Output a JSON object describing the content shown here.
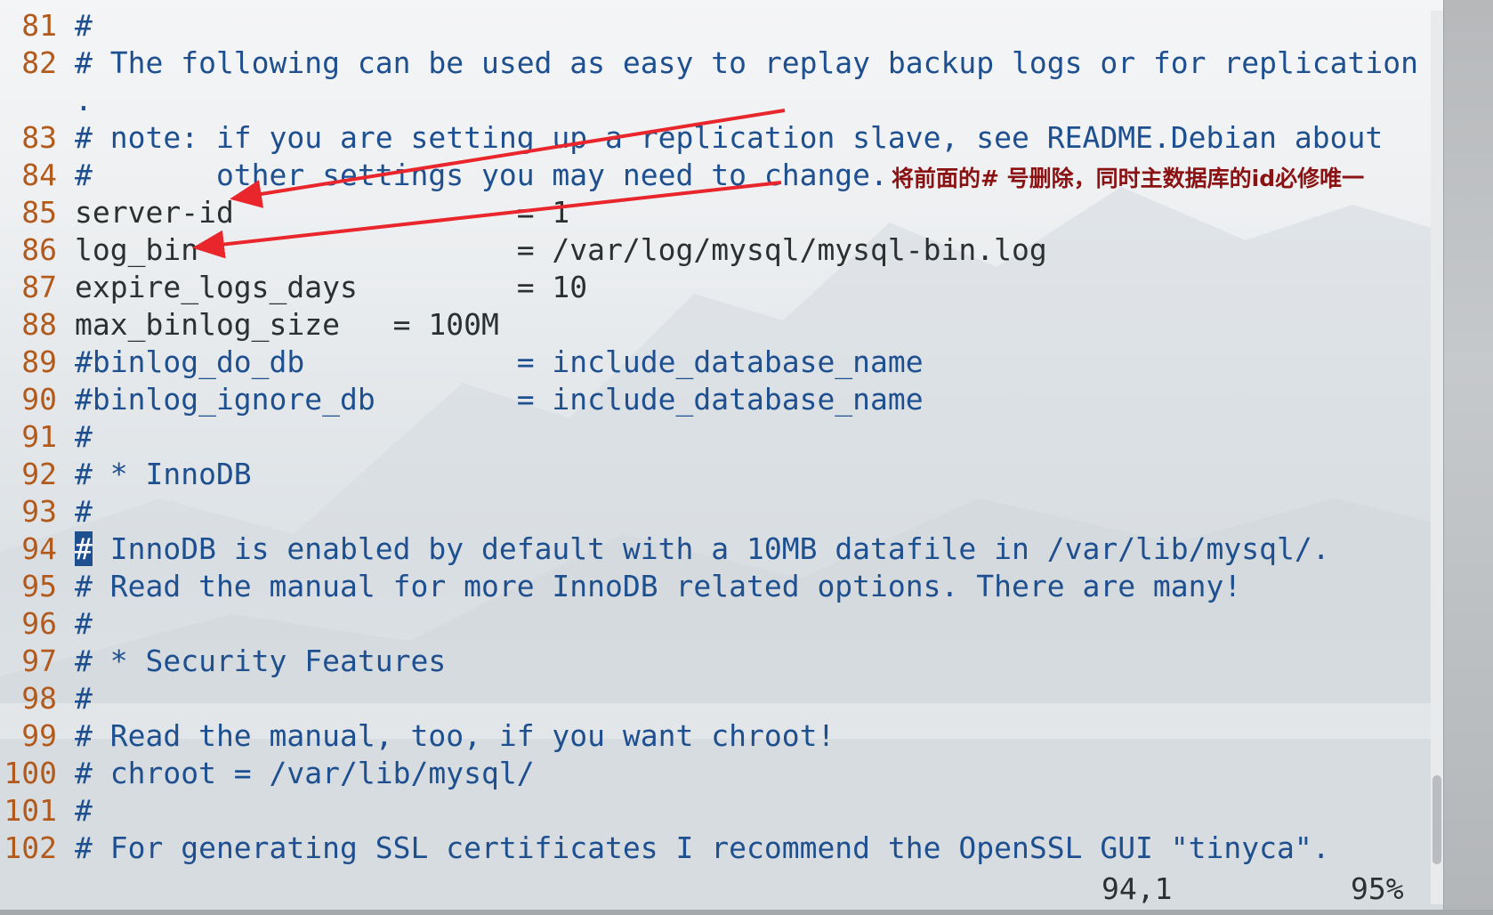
{
  "editor": {
    "lines": [
      {
        "num": "81",
        "parts": [
          {
            "t": "#",
            "c": "cm"
          }
        ]
      },
      {
        "num": "82",
        "parts": [
          {
            "t": "# The following can be used as easy to replay backup logs or for replication",
            "c": "cm"
          }
        ]
      },
      {
        "num": "",
        "parts": [
          {
            "t": ".",
            "c": "cm"
          }
        ]
      },
      {
        "num": "83",
        "parts": [
          {
            "t": "# note: if you are setting up a replication slave, see README.Debian about",
            "c": "cm"
          }
        ]
      },
      {
        "num": "84",
        "parts": [
          {
            "t": "#       other settings you may need to change.",
            "c": "cm"
          }
        ]
      },
      {
        "num": "85",
        "parts": [
          {
            "t": "server-id                = 1",
            "c": "tx"
          }
        ]
      },
      {
        "num": "86",
        "parts": [
          {
            "t": "log_bin                  = /var/log/mysql/mysql-bin.log",
            "c": "tx"
          }
        ]
      },
      {
        "num": "87",
        "parts": [
          {
            "t": "expire_logs_days         = 10",
            "c": "tx"
          }
        ]
      },
      {
        "num": "88",
        "parts": [
          {
            "t": "max_binlog_size   = 100M",
            "c": "tx"
          }
        ]
      },
      {
        "num": "89",
        "parts": [
          {
            "t": "#binlog_do_db            = include_database_name",
            "c": "cm"
          }
        ]
      },
      {
        "num": "90",
        "parts": [
          {
            "t": "#binlog_ignore_db        = include_database_name",
            "c": "cm"
          }
        ]
      },
      {
        "num": "91",
        "parts": [
          {
            "t": "#",
            "c": "cm"
          }
        ]
      },
      {
        "num": "92",
        "parts": [
          {
            "t": "# * InnoDB",
            "c": "cm"
          }
        ]
      },
      {
        "num": "93",
        "parts": [
          {
            "t": "#",
            "c": "cm"
          }
        ]
      },
      {
        "num": "94",
        "parts": [
          {
            "t": "#",
            "c": "cursor"
          },
          {
            "t": " InnoDB is enabled by default with a 10MB datafile in /var/lib/mysql/.",
            "c": "cm"
          }
        ]
      },
      {
        "num": "95",
        "parts": [
          {
            "t": "# Read the manual for more InnoDB related options. There are many!",
            "c": "cm"
          }
        ]
      },
      {
        "num": "96",
        "parts": [
          {
            "t": "#",
            "c": "cm"
          }
        ]
      },
      {
        "num": "97",
        "parts": [
          {
            "t": "# * Security Features",
            "c": "cm"
          }
        ]
      },
      {
        "num": "98",
        "parts": [
          {
            "t": "#",
            "c": "cm"
          }
        ]
      },
      {
        "num": "99",
        "parts": [
          {
            "t": "# Read the manual, too, if you want chroot!",
            "c": "cm"
          }
        ]
      },
      {
        "num": "100",
        "parts": [
          {
            "t": "# chroot = /var/lib/mysql/",
            "c": "cm"
          }
        ]
      },
      {
        "num": "101",
        "parts": [
          {
            "t": "#",
            "c": "cm"
          }
        ]
      },
      {
        "num": "102",
        "parts": [
          {
            "t": "# For generating SSL certificates I recommend the OpenSSL GUI \"tinyca\".",
            "c": "cm"
          }
        ]
      }
    ]
  },
  "annotation": {
    "text": "将前面的# 号删除，同时主数据库的id必修唯一",
    "color": "#e8262b"
  },
  "status": {
    "position": "94,1",
    "percent": "95%"
  },
  "scroll": {
    "fraction": 0.95
  },
  "colors": {
    "comment": "#1e4f8f",
    "line_number": "#b25a1c",
    "text": "#2b3030",
    "annotation_text": "#8a1212",
    "arrow": "#e8262b"
  }
}
